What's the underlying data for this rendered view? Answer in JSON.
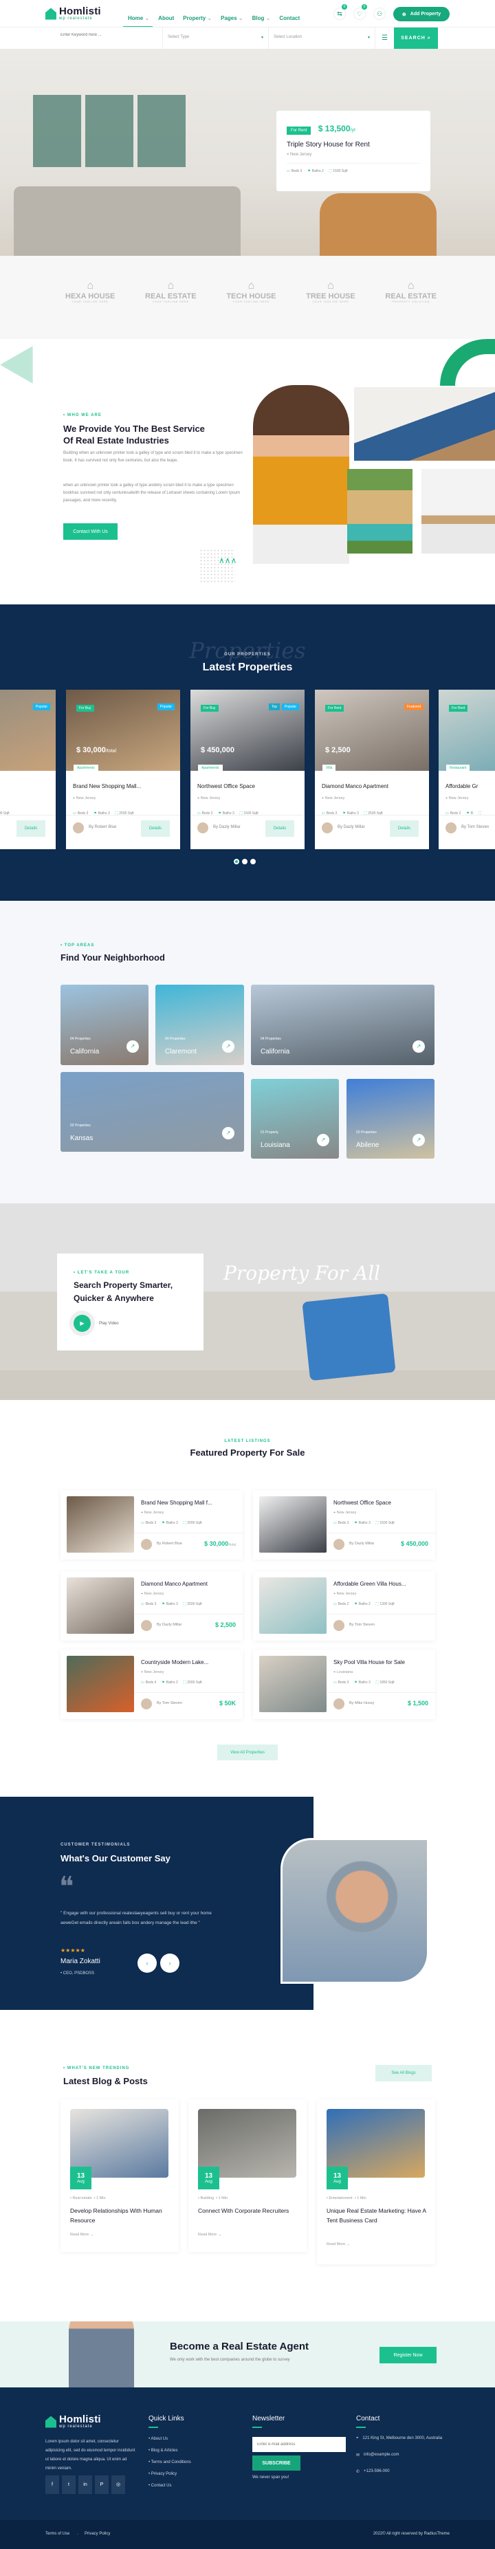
{
  "colors": {
    "accent": "#1cc08f",
    "navy": "#0e2b50"
  },
  "header": {
    "logo": "Homlisti",
    "logo_sub": "wp realestate",
    "nav": [
      {
        "label": "Home",
        "chev": true
      },
      {
        "label": "About"
      },
      {
        "label": "Property",
        "chev": true
      },
      {
        "label": "Pages",
        "chev": true
      },
      {
        "label": "Blog",
        "chev": true
      },
      {
        "label": "Contact"
      }
    ],
    "compare_count": "0",
    "wishlist_count": "0",
    "add_property": "Add Property"
  },
  "search": {
    "keyword_placeholder": "Enter Keyword here ...",
    "type": "Select Type",
    "location": "Select Location",
    "button": "SEARCH"
  },
  "hero": {
    "tag": "For Rent",
    "price": "$ 13,500",
    "per": "/yr",
    "title": "Triple Story House for Rent",
    "location": "New Jersey",
    "beds": "Beds 3",
    "baths": "Baths 2",
    "area": "1500 Sqft"
  },
  "brands": [
    {
      "name": "HEXA HOUSE",
      "tag": "YOUR TAGLINE HERE"
    },
    {
      "name": "REAL ESTATE",
      "tag": "YOUR TAGLINE HERE"
    },
    {
      "name": "TECH HOUSE",
      "tag": "YOUR TAGLINE HERE"
    },
    {
      "name": "TREE HOUSE",
      "tag": "YOUR TAGLINE HERE"
    },
    {
      "name": "REAL ESTATE",
      "tag": "PROPERTY SOLUTION"
    }
  ],
  "about": {
    "label": "WHO WE ARE",
    "title1": "We Provide You The Best Service",
    "title2": "Of Real Estate Industries",
    "p1": "Building when an unknown printer took a galley of type and scram bled it to make a type specimen book. It has survived not only five centuries, but also the leape.",
    "p2": "when an unknown printer took a galley of type andetry scram bled it to make a type specimen bookhas survived not only centuriesalwith the release of Letraset sheets containing Lorem Ipsum passages, and more recently.",
    "button": "Contact With Us"
  },
  "latest": {
    "label": "OUR PROPERTIES",
    "title": "Latest Properties",
    "script": "Properties",
    "details": "Details",
    "cards": [
      {
        "tags": [],
        "flags": [
          {
            "t": "Popular",
            "c": "#17b8f0"
          }
        ],
        "price": "",
        "per": "",
        "cat": "",
        "title": "Triple Story House for Rent",
        "loc": "New Jersey",
        "beds": "Beds 3",
        "baths": "Baths 2",
        "area": "1500 Sqft",
        "agent": ""
      },
      {
        "tags": [
          "For Buy"
        ],
        "flags": [
          {
            "t": "Popular",
            "c": "#17b8f0"
          }
        ],
        "price": "$ 30,000",
        "per": "/total",
        "cat": "Apartments",
        "title": "Brand New Shopping Mall...",
        "loc": "New Jersey",
        "beds": "Beds 3",
        "baths": "Baths 3",
        "area": "2000 Sqft",
        "agent": "By Robert Blue"
      },
      {
        "tags": [
          "For Buy"
        ],
        "flags": [
          {
            "t": "Popular",
            "c": "#17b8f0"
          },
          {
            "t": "Top",
            "c": "#1ca9c9"
          }
        ],
        "price": "$ 450,000",
        "per": "",
        "cat": "Apartments",
        "title": "Northwest Office Space",
        "loc": "New Jersey",
        "beds": "Beds 3",
        "baths": "Baths 3",
        "area": "1500 Sqft",
        "agent": "By Dazly Millar"
      },
      {
        "tags": [
          "For Rent"
        ],
        "flags": [
          {
            "t": "Featured",
            "c": "#f58b3a"
          }
        ],
        "price": "$ 2,500",
        "per": "",
        "cat": "Villa",
        "title": "Diamond Manco Apartment",
        "loc": "New Jersey",
        "beds": "Beds 3",
        "baths": "Baths 3",
        "area": "2500 Sqft",
        "agent": "By Dazly Millar"
      },
      {
        "tags": [
          "For Rent"
        ],
        "flags": [],
        "price": "",
        "per": "",
        "cat": "Restaurant",
        "title": "Affordable Gr",
        "loc": "New Jersey",
        "beds": "Beds 2",
        "baths": "B",
        "area": "",
        "agent": "By Tom Steven"
      }
    ],
    "active_slide": 1,
    "slides": 3
  },
  "areas": {
    "label": "TOP AREAS",
    "title": "Find Your Neighborhood",
    "tiles": [
      {
        "count": "04 Properties",
        "name": "California"
      },
      {
        "count": "04 Properties",
        "name": "Claremont"
      },
      {
        "count": "04 Properties",
        "name": "California"
      },
      {
        "count": "02 Properties",
        "name": "Kansas"
      },
      {
        "count": "01 Property",
        "name": "Louisiana"
      },
      {
        "count": "02 Properties",
        "name": "Abilene"
      }
    ]
  },
  "tour": {
    "label": "LET'S TAKE A TOUR",
    "title1": "Search Property Smarter,",
    "title2": "Quicker & Anywhere",
    "play": "Play Video",
    "script": "Property For All"
  },
  "featured": {
    "label": "LATEST LISTINGS",
    "title": "Featured Property For Sale",
    "button": "View All Properties",
    "cards": [
      {
        "title": "Brand New Shopping Mall f...",
        "loc": "New Jersey",
        "beds": "Beds 3",
        "baths": "Baths 3",
        "area": "2000 Sqft",
        "agent": "By Robert Blue",
        "price": "$ 30,000",
        "per": "/total"
      },
      {
        "title": "Northwest Office Space",
        "loc": "New Jersey",
        "beds": "Beds 3",
        "baths": "Baths 3",
        "area": "1500 Sqft",
        "agent": "By Dazly Millar",
        "price": "$ 450,000",
        "per": ""
      },
      {
        "title": "Diamond Manco Apartment",
        "loc": "New Jersey",
        "beds": "Beds 3",
        "baths": "Baths 3",
        "area": "2500 Sqft",
        "agent": "By Dazly Millar",
        "price": "$ 2,500",
        "per": ""
      },
      {
        "title": "Affordable Green Villa Hous...",
        "loc": "New Jersey",
        "beds": "Beds 2",
        "baths": "Baths 2",
        "area": "1300 Sqft",
        "agent": "By Tom Steven",
        "price": "",
        "per": ""
      },
      {
        "title": "Countryside Modern Lake...",
        "loc": "New Jersey",
        "beds": "Beds 4",
        "baths": "Baths 2",
        "area": "2000 Sqft",
        "agent": "By Tom Steven",
        "price": "$ 50K",
        "per": ""
      },
      {
        "title": "Sky Pool Villa House for Sale",
        "loc": "Louisiana",
        "beds": "Beds 3",
        "baths": "Baths 3",
        "area": "1850 Sqft",
        "agent": "By Mike Hussy",
        "price": "$ 1,500",
        "per": ""
      }
    ]
  },
  "testimonial": {
    "label": "CUSTOMER TESTIMONIALS",
    "title": "What's Our Customer Say",
    "quote": "\" Engage with our professional realestaeyeagents sell buy or rent your home aeweGet emails directly areain falls box andery manage the lead ithe \"",
    "rating": 5,
    "name": "Maria Zokatti",
    "role": "CEO, PSDBOSS"
  },
  "blog": {
    "label": "WHAT'S NEW TRENDING",
    "title": "Latest Blog & Posts",
    "button": "See All Blogs",
    "read_more": "Read More",
    "posts": [
      {
        "day": "13",
        "month": "Aug",
        "cat": "Real-estate",
        "time": "1 Min",
        "title": "Develop Relationships With Human Resource"
      },
      {
        "day": "13",
        "month": "Aug",
        "cat": "Building",
        "time": "1 Min",
        "title": "Connect With Corporate Recruiters"
      },
      {
        "day": "13",
        "month": "Aug",
        "cat": "Entertainment",
        "time": "1 Min",
        "title": "Unique Real Estate Marketing: Have A Tent Business Card"
      }
    ]
  },
  "cta": {
    "title": "Become a Real Estate Agent",
    "subtitle": "We only work with the best companies around the globe to survey",
    "button": "Register Now"
  },
  "footer": {
    "about": "Lorem ipsum dolor sit amet, consectetur adipisicing elit, sed do eiusmod tempor incididunt ut labore et dolore magna aliqua. Ut enim ad minim veniam.",
    "social": [
      "facebook",
      "twitter",
      "linkedin",
      "pinterest",
      "instagram"
    ],
    "quick_title": "Quick Links",
    "links": [
      "About Us",
      "Blog & Articles",
      "Terms and Conditions",
      "Privacy Policy",
      "Contact Us"
    ],
    "news_title": "Newsletter",
    "email_placeholder": "Enter e-mail address",
    "subscribe": "SUBSCRIBE",
    "news_note": "We never span you!",
    "contact_title": "Contact",
    "address": "121 King St, Melbourne den 3000, Australia",
    "email": "info@example.com",
    "phone": "+123-596-000",
    "terms": "Terms of Use",
    "privacy": "Privacy Policy",
    "copyright": "2022© All right reserved by RadiusTheme"
  }
}
